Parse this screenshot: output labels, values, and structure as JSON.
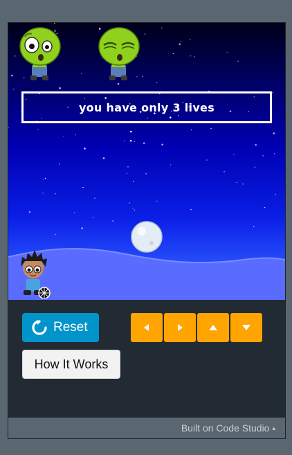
{
  "game": {
    "lives_message": "you have only 3 lives",
    "colors": {
      "sky_top": "#00001a",
      "sky_bottom": "#3a6aff",
      "ground": "#5a6cff",
      "zombie_skin": "#8fd11c",
      "snowball": "#e4ecf5"
    },
    "sprites": {
      "zombie_1": "zombie-awake-icon",
      "zombie_2": "zombie-sleeping-icon",
      "projectile": "snowball-icon",
      "player": "kid-with-ball-icon"
    }
  },
  "controls": {
    "reset_label": "Reset",
    "reset_icon": "reset-icon",
    "how_label": "How It Works",
    "arrows": [
      "arrow-left-icon",
      "arrow-right-icon",
      "arrow-up-icon",
      "arrow-down-icon"
    ],
    "accent_orange": "#ffa400",
    "accent_blue": "#0094ca"
  },
  "footer": {
    "label": "Built on Code Studio",
    "caret": "▴"
  }
}
